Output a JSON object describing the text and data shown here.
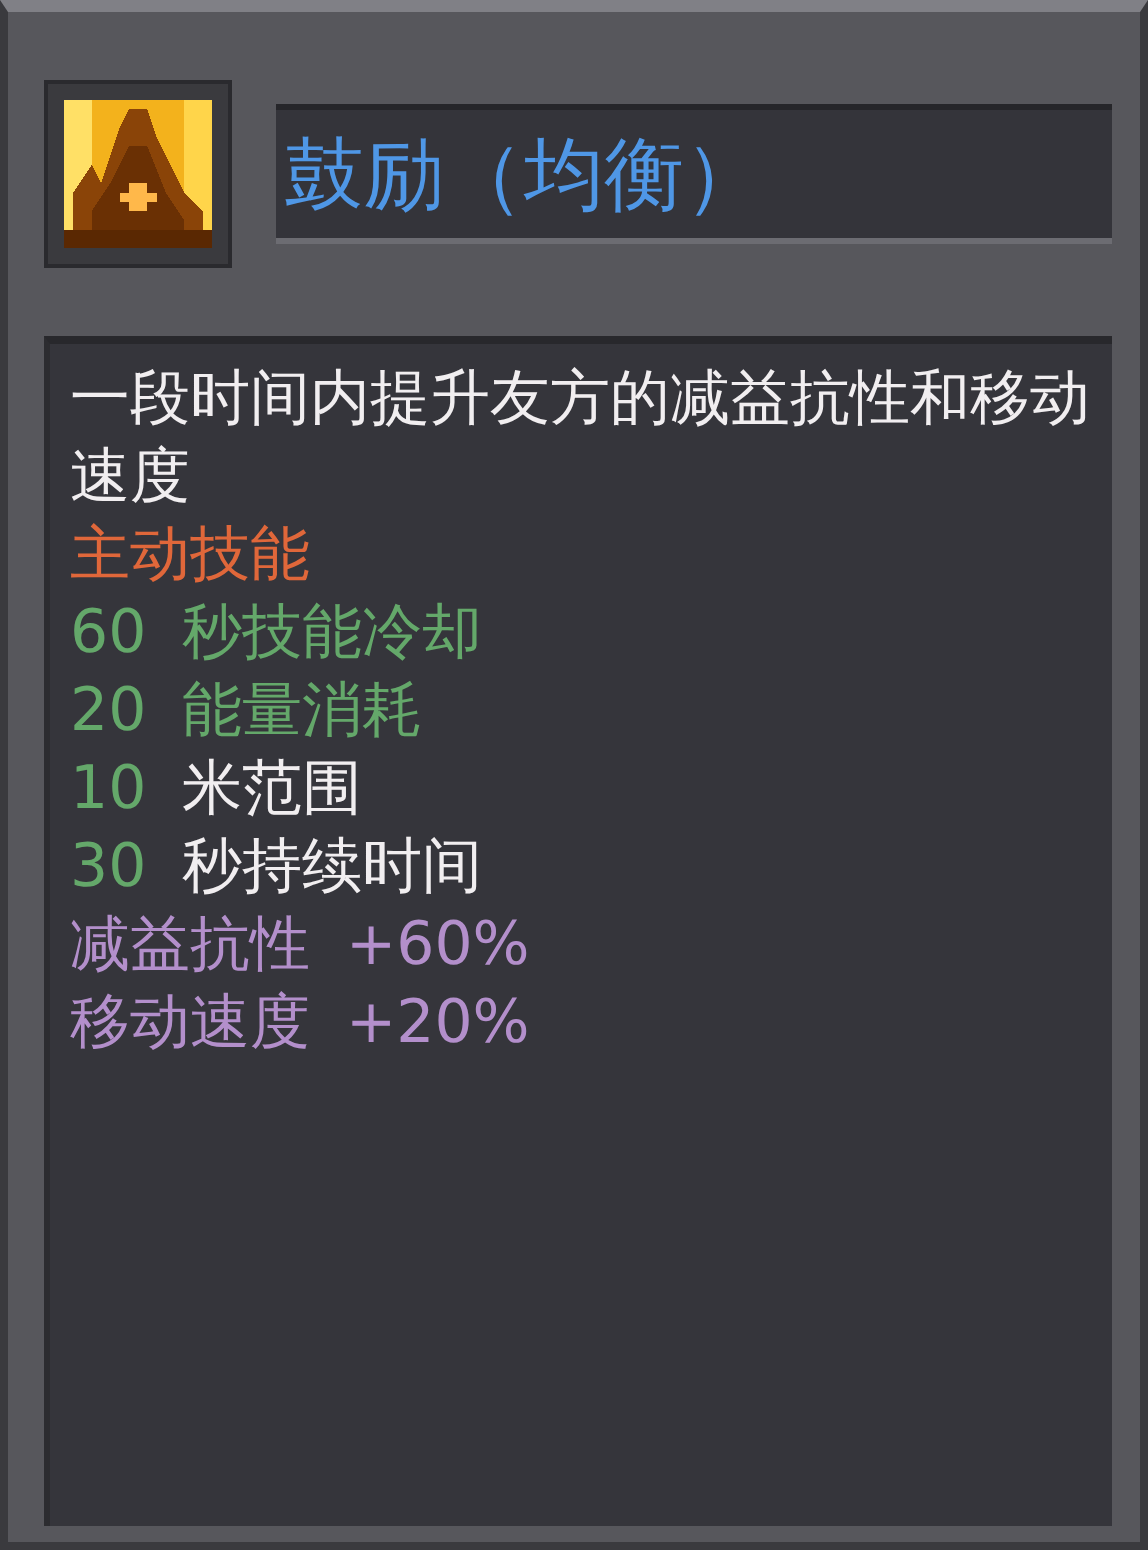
{
  "skill": {
    "title": "鼓励（均衡）"
  },
  "description": "一段时间内提升友方的减益抗性和移动速度",
  "skill_type": "主动技能",
  "stats": [
    {
      "value": "60",
      "text": "秒技能冷却",
      "kind": "cost"
    },
    {
      "value": "20",
      "text": "能量消耗",
      "kind": "cost"
    },
    {
      "value": "10",
      "text": "米范围",
      "kind": "info"
    },
    {
      "value": "30",
      "text": "秒持续时间",
      "kind": "info"
    }
  ],
  "bonuses": [
    {
      "label": "减益抗性",
      "value": "+60%"
    },
    {
      "label": "移动速度",
      "value": "+20%"
    }
  ]
}
